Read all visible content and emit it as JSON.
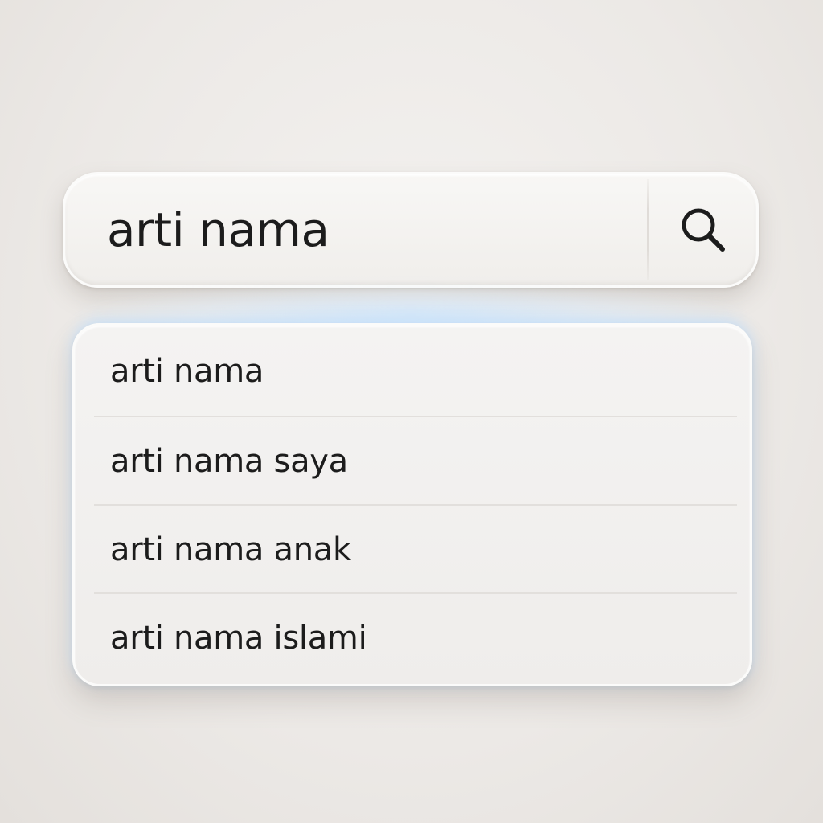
{
  "search": {
    "value": "arti nama",
    "button_icon": "search-icon"
  },
  "suggestions": [
    {
      "label": "arti nama"
    },
    {
      "label": "arti nama saya"
    },
    {
      "label": "arti nama anak"
    },
    {
      "label": "arti nama islami"
    }
  ],
  "colors": {
    "background": "#ece9e6",
    "surface": "#f3f1ef",
    "text": "#1c1c1c",
    "glow": "#c8e4ff",
    "divider": "#e2dfdc"
  }
}
